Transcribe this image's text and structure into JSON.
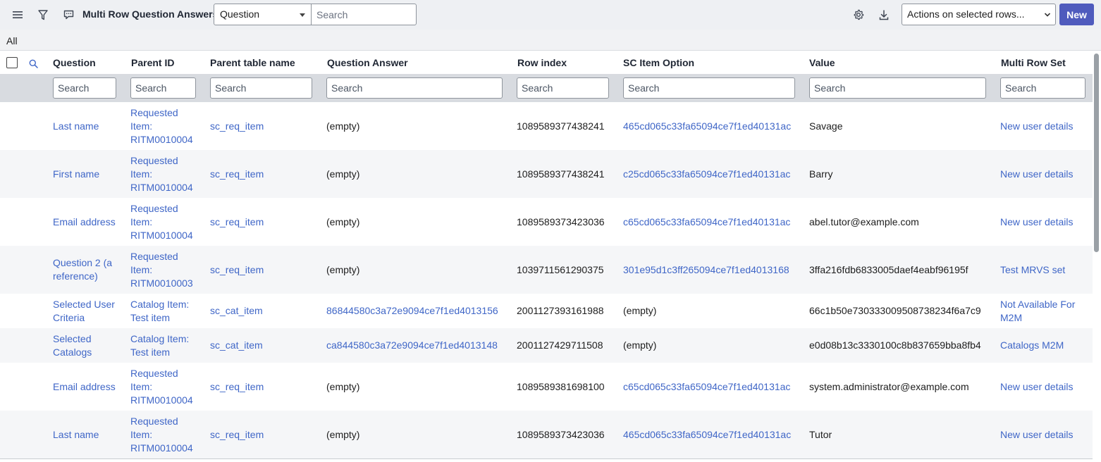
{
  "toolbar": {
    "title": "Multi Row Question Answers",
    "field_select_value": "Question",
    "search_placeholder": "Search",
    "actions_label": "Actions on selected rows...",
    "new_label": "New",
    "icons": [
      "hamburger-menu-icon",
      "filter-icon",
      "chat-icon",
      "gear-icon",
      "download-icon"
    ]
  },
  "breadcrumb": "All",
  "columns": [
    {
      "key": "question",
      "label": "Question"
    },
    {
      "key": "parent_id",
      "label": "Parent ID"
    },
    {
      "key": "parent_table",
      "label": "Parent table name"
    },
    {
      "key": "answer",
      "label": "Question Answer"
    },
    {
      "key": "row_index",
      "label": "Row index"
    },
    {
      "key": "sc_item_option",
      "label": "SC Item Option"
    },
    {
      "key": "value",
      "label": "Value"
    },
    {
      "key": "multi_row_set",
      "label": "Multi Row Set"
    }
  ],
  "column_search_placeholder": "Search",
  "rows": [
    {
      "question": "Last name",
      "parent_id": [
        "Requested",
        "Item:",
        "RITM0010004"
      ],
      "parent_table": "sc_req_item",
      "answer": "(empty)",
      "row_index": "1089589377438241",
      "sc_item_option": "465cd065c33fa65094ce7f1ed40131ac",
      "value": "Savage",
      "multi_row_set": [
        "New user details"
      ]
    },
    {
      "question": "First name",
      "parent_id": [
        "Requested",
        "Item:",
        "RITM0010004"
      ],
      "parent_table": "sc_req_item",
      "answer": "(empty)",
      "row_index": "1089589377438241",
      "sc_item_option": "c25cd065c33fa65094ce7f1ed40131ac",
      "value": "Barry",
      "multi_row_set": [
        "New user details"
      ]
    },
    {
      "question": "Email address",
      "parent_id": [
        "Requested",
        "Item:",
        "RITM0010004"
      ],
      "parent_table": "sc_req_item",
      "answer": "(empty)",
      "row_index": "1089589373423036",
      "sc_item_option": "c65cd065c33fa65094ce7f1ed40131ac",
      "value": "abel.tutor@example.com",
      "multi_row_set": [
        "New user details"
      ]
    },
    {
      "question": "Question 2 (a reference)",
      "parent_id": [
        "Requested",
        "Item:",
        "RITM0010003"
      ],
      "parent_table": "sc_req_item",
      "answer": "(empty)",
      "row_index": "1039711561290375",
      "sc_item_option": "301e95d1c3ff265094ce7f1ed4013168",
      "value": "3ffa216fdb6833005daef4eabf96195f",
      "multi_row_set": [
        "Test MRVS set"
      ]
    },
    {
      "question": "Selected User Criteria",
      "parent_id": [
        "Catalog Item:",
        "Test item"
      ],
      "parent_table": "sc_cat_item",
      "answer": "86844580c3a72e9094ce7f1ed4013156",
      "row_index": "2001127393161988",
      "sc_item_option": "(empty)",
      "value": "66c1b50e730333009508738234f6a7c9",
      "multi_row_set": [
        "Not Available For",
        "M2M"
      ]
    },
    {
      "question": "Selected Catalogs",
      "parent_id": [
        "Catalog Item:",
        "Test item"
      ],
      "parent_table": "sc_cat_item",
      "answer": "ca844580c3a72e9094ce7f1ed4013148",
      "row_index": "2001127429711508",
      "sc_item_option": "(empty)",
      "value": "e0d08b13c3330100c8b837659bba8fb4",
      "multi_row_set": [
        "Catalogs M2M"
      ]
    },
    {
      "question": "Email address",
      "parent_id": [
        "Requested",
        "Item:",
        "RITM0010004"
      ],
      "parent_table": "sc_req_item",
      "answer": "(empty)",
      "row_index": "1089589381698100",
      "sc_item_option": "c65cd065c33fa65094ce7f1ed40131ac",
      "value": "system.administrator@example.com",
      "multi_row_set": [
        "New user details"
      ]
    },
    {
      "question": "Last name",
      "parent_id": [
        "Requested",
        "Item:",
        "RITM0010004"
      ],
      "parent_table": "sc_req_item",
      "answer": "(empty)",
      "row_index": "1089589373423036",
      "sc_item_option": "465cd065c33fa65094ce7f1ed40131ac",
      "value": "Tutor",
      "multi_row_set": [
        "New user details"
      ]
    }
  ]
}
